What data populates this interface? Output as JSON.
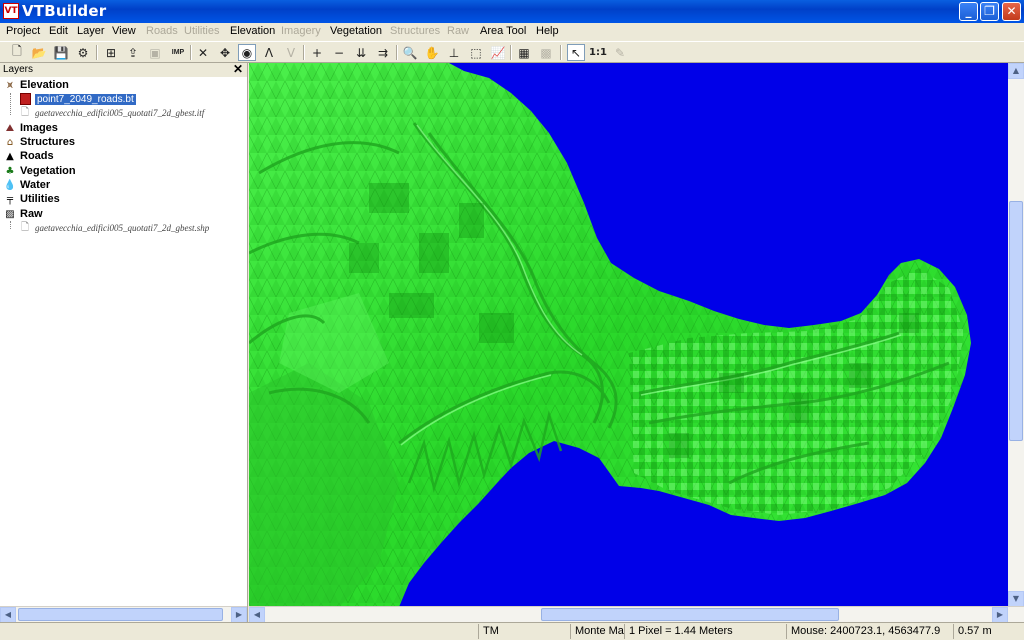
{
  "window": {
    "title": "VTBuilder",
    "icon_text": "VT",
    "minimize": "_",
    "maximize": "❐",
    "close": "✕"
  },
  "menu": {
    "project": "Project",
    "edit": "Edit",
    "layer": "Layer",
    "view": "View",
    "roads": "Roads",
    "utilities": "Utilities",
    "elevation": "Elevation",
    "imagery": "Imagery",
    "vegetation": "Vegetation",
    "structures": "Structures",
    "raw": "Raw",
    "area_tool": "Area Tool",
    "help": "Help"
  },
  "toolbar": {
    "imp_label": "IMP",
    "scale_1to1": "1:1"
  },
  "layers": {
    "header": "Layers",
    "close": "✕",
    "groups": [
      {
        "label": "Elevation",
        "children": [
          "point7_2049_roads.bt",
          "gaetavecchia_edifici005_quotati7_2d_gbest.itf"
        ]
      },
      {
        "label": "Images"
      },
      {
        "label": "Structures"
      },
      {
        "label": "Roads"
      },
      {
        "label": "Vegetation"
      },
      {
        "label": "Water"
      },
      {
        "label": "Utilities"
      },
      {
        "label": "Raw",
        "children": [
          "gaetavecchia_edifici005_quotati7_2d_gbest.shp"
        ]
      }
    ]
  },
  "status": {
    "projection": "TM",
    "datum": "Monte Mar",
    "pixel": "1 Pixel = 1.44 Meters",
    "mouse": "Mouse: 2400723.1, 4563477.9",
    "elev": "0.57 m"
  },
  "colors": {
    "water": "#0000e8",
    "land": "#33e833",
    "titlebar": "#0050e0",
    "selection": "#316ac5"
  }
}
